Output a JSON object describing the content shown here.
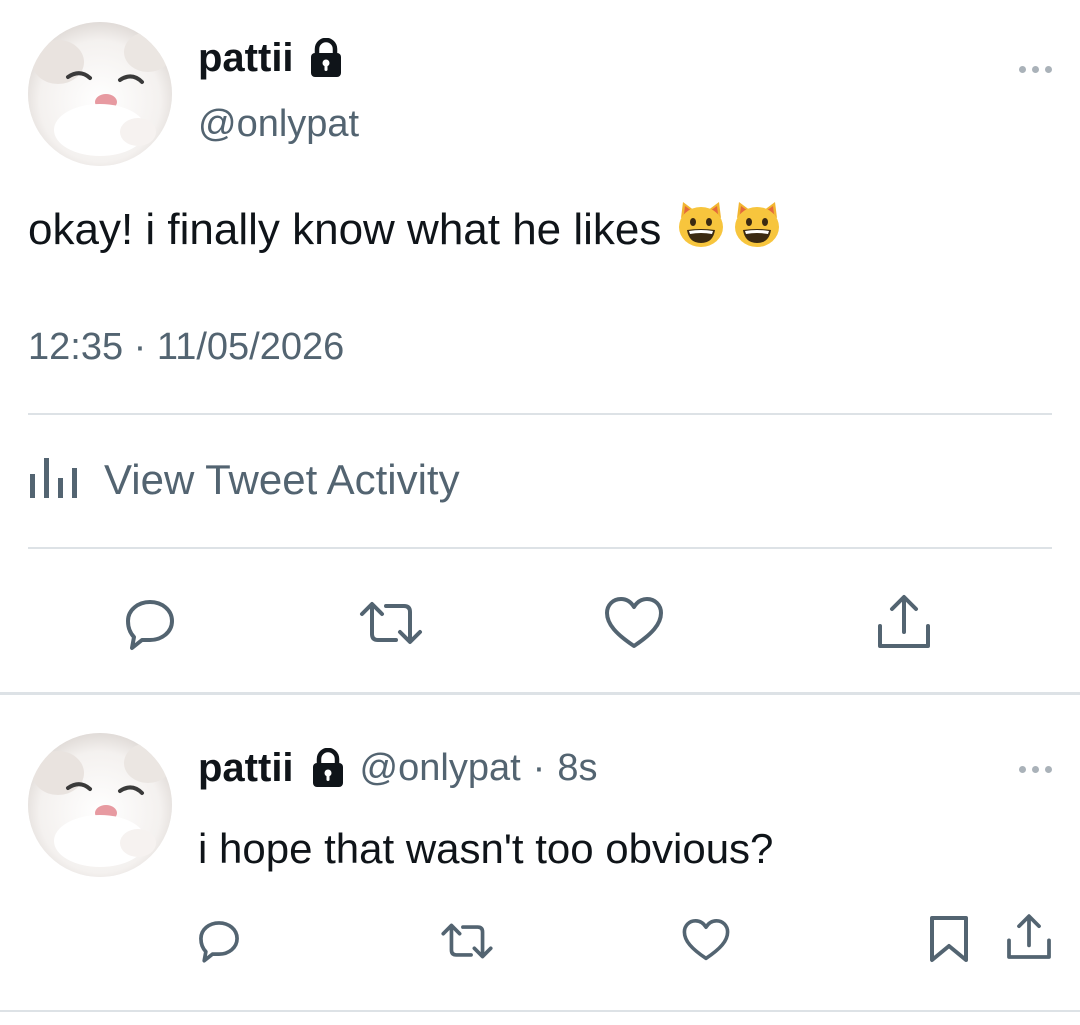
{
  "main_tweet": {
    "display_name": "pattii",
    "handle": "@onlypat",
    "text": "okay! i finally know what he likes",
    "emojis": [
      "grinning-cat-emoji",
      "grinning-cat-emoji"
    ],
    "time": "12:35",
    "separator": "·",
    "date": "11/05/2026",
    "activity_label": "View Tweet Activity",
    "actions": [
      "reply-icon",
      "retweet-icon",
      "like-icon",
      "share-icon"
    ]
  },
  "reply_tweet": {
    "display_name": "pattii",
    "handle": "@onlypat",
    "separator": "·",
    "time_ago": "8s",
    "text": "i hope that wasn't too obvious?",
    "actions": [
      "reply-icon",
      "retweet-icon",
      "like-icon",
      "bookmark-icon",
      "share-icon"
    ]
  },
  "colors": {
    "text_primary": "#0f1419",
    "text_secondary": "#536471",
    "divider": "#dde2e6",
    "icon": "#536471"
  }
}
